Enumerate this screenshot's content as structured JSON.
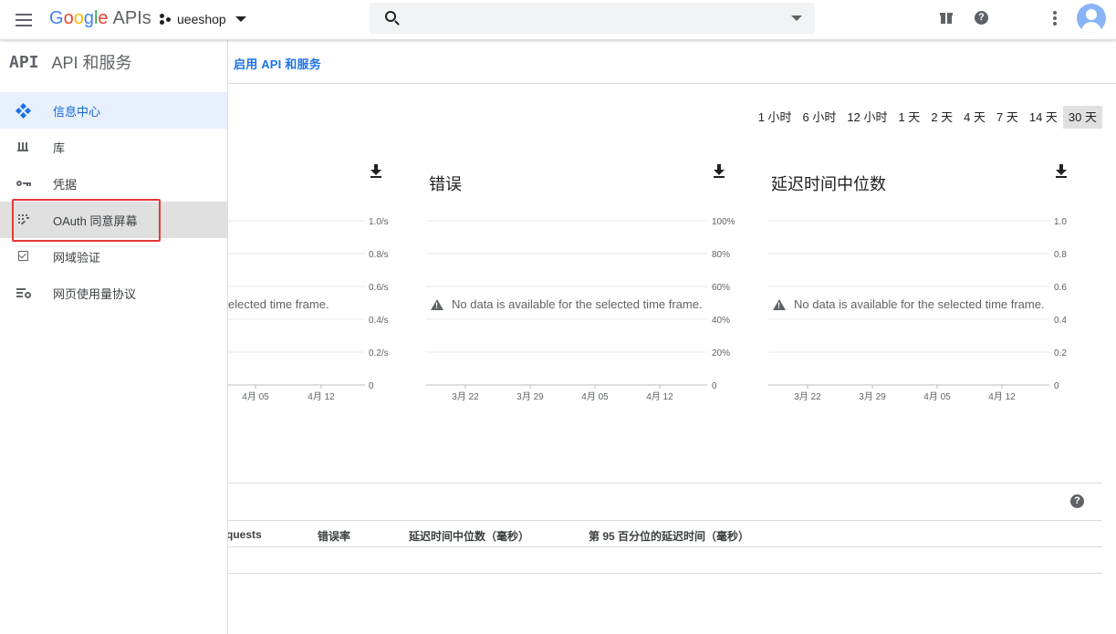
{
  "topbar": {
    "logo_google": [
      "G",
      "o",
      "o",
      "g",
      "l",
      "e"
    ],
    "logo_apis": "APIs",
    "project_name": "ueeshop",
    "search_placeholder": ""
  },
  "sidebar": {
    "api_logo": "API",
    "title": "API 和服务",
    "items": [
      {
        "label": "信息中心",
        "icon": "dashboard-icon",
        "state": "active"
      },
      {
        "label": "库",
        "icon": "library-icon",
        "state": "normal"
      },
      {
        "label": "凭据",
        "icon": "key-icon",
        "state": "normal"
      },
      {
        "label": "OAuth 同意屏幕",
        "icon": "oauth-consent-icon",
        "state": "hover"
      },
      {
        "label": "网域验证",
        "icon": "checkbox-icon",
        "state": "normal"
      },
      {
        "label": "网页使用量协议",
        "icon": "usage-settings-icon",
        "state": "normal"
      }
    ]
  },
  "main": {
    "enable_link": "启用 API 和服务",
    "time_ranges": [
      "1 小时",
      "6 小时",
      "12 小时",
      "1 天",
      "2 天",
      "4 天",
      "7 天",
      "14 天",
      "30 天"
    ],
    "selected_range": "30 天",
    "charts": [
      {
        "title": "",
        "no_data": "No data is available for the selected time frame.",
        "yticks": [
          "1.0/s",
          "0.8/s",
          "0.6/s",
          "0.4/s",
          "0.2/s",
          "0"
        ],
        "xticks": [
          "4月 05",
          "4月 12"
        ]
      },
      {
        "title": "错误",
        "no_data": "No data is available for the selected time frame.",
        "yticks": [
          "100%",
          "80%",
          "60%",
          "40%",
          "20%",
          "0"
        ],
        "xticks": [
          "3月 22",
          "3月 29",
          "4月 05",
          "4月 12"
        ]
      },
      {
        "title": "延迟时间中位数",
        "no_data": "No data is available for the selected time frame.",
        "yticks": [
          "1.0",
          "0.8",
          "0.6",
          "0.4",
          "0.2",
          "0"
        ],
        "xticks": [
          "3月 22",
          "3月 29",
          "4月 05",
          "4月 12"
        ]
      }
    ],
    "table": {
      "columns": [
        "quests",
        "错误率",
        "延迟时间中位数（毫秒）",
        "第 95 百分位的延迟时间（毫秒）"
      ]
    }
  },
  "colors": {
    "accent": "#1a73e8",
    "highlight_border": "#e53935",
    "active_bg": "#e8f0fe"
  }
}
